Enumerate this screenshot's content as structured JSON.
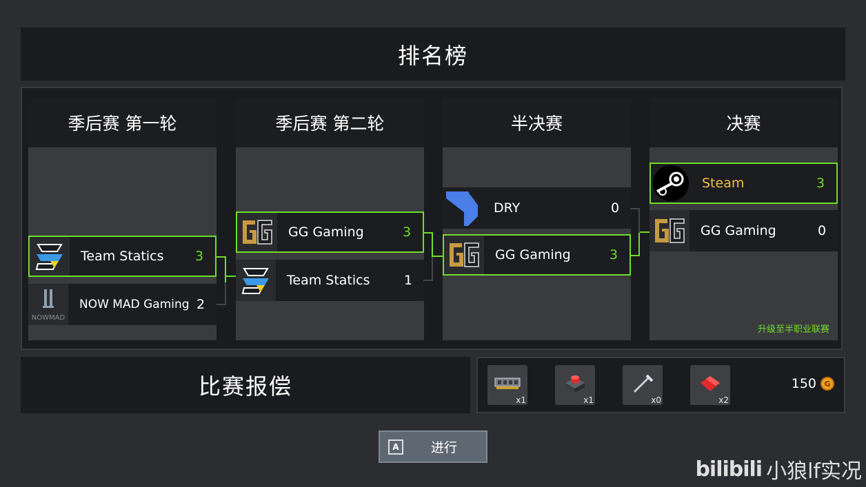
{
  "header": {
    "title": "排名榜"
  },
  "bracket": {
    "columns": [
      {
        "title": "季后赛 第一轮"
      },
      {
        "title": "季后赛 第二轮"
      },
      {
        "title": "半决赛"
      },
      {
        "title": "决赛"
      }
    ],
    "round1": [
      {
        "name": "Team Statics",
        "score": "3",
        "winner": true
      },
      {
        "name": "NOW MAD Gaming",
        "score": "2",
        "winner": false
      }
    ],
    "round2": [
      {
        "name": "GG Gaming",
        "score": "3",
        "winner": true
      },
      {
        "name": "Team Statics",
        "score": "1",
        "winner": false
      }
    ],
    "semifinal": [
      {
        "name": "DRY",
        "score": "0",
        "winner": false
      },
      {
        "name": "GG Gaming",
        "score": "3",
        "winner": true
      }
    ],
    "final": [
      {
        "name": "Steam",
        "score": "3",
        "winner": true
      },
      {
        "name": "GG Gaming",
        "score": "0",
        "winner": false
      }
    ],
    "promotion_note": "升级至半职业联赛"
  },
  "rewards": {
    "title": "比赛报偿",
    "items": [
      {
        "icon": "ram-chip-icon",
        "qty": "x1"
      },
      {
        "icon": "arcade-button-icon",
        "qty": "x1"
      },
      {
        "icon": "screwdriver-icon",
        "qty": "x0"
      },
      {
        "icon": "red-cloth-icon",
        "qty": "x2"
      }
    ],
    "coins": "150",
    "coin_symbol": "G"
  },
  "actions": {
    "proceed_label": "进行",
    "proceed_key": "A"
  },
  "watermark": {
    "logo": "bilibili",
    "text": "小狼lf实况"
  },
  "colors": {
    "win": "#6fdd2a",
    "champion_name": "#f0c040",
    "background": "#2b2d30",
    "panel": "#1a1b1e"
  }
}
